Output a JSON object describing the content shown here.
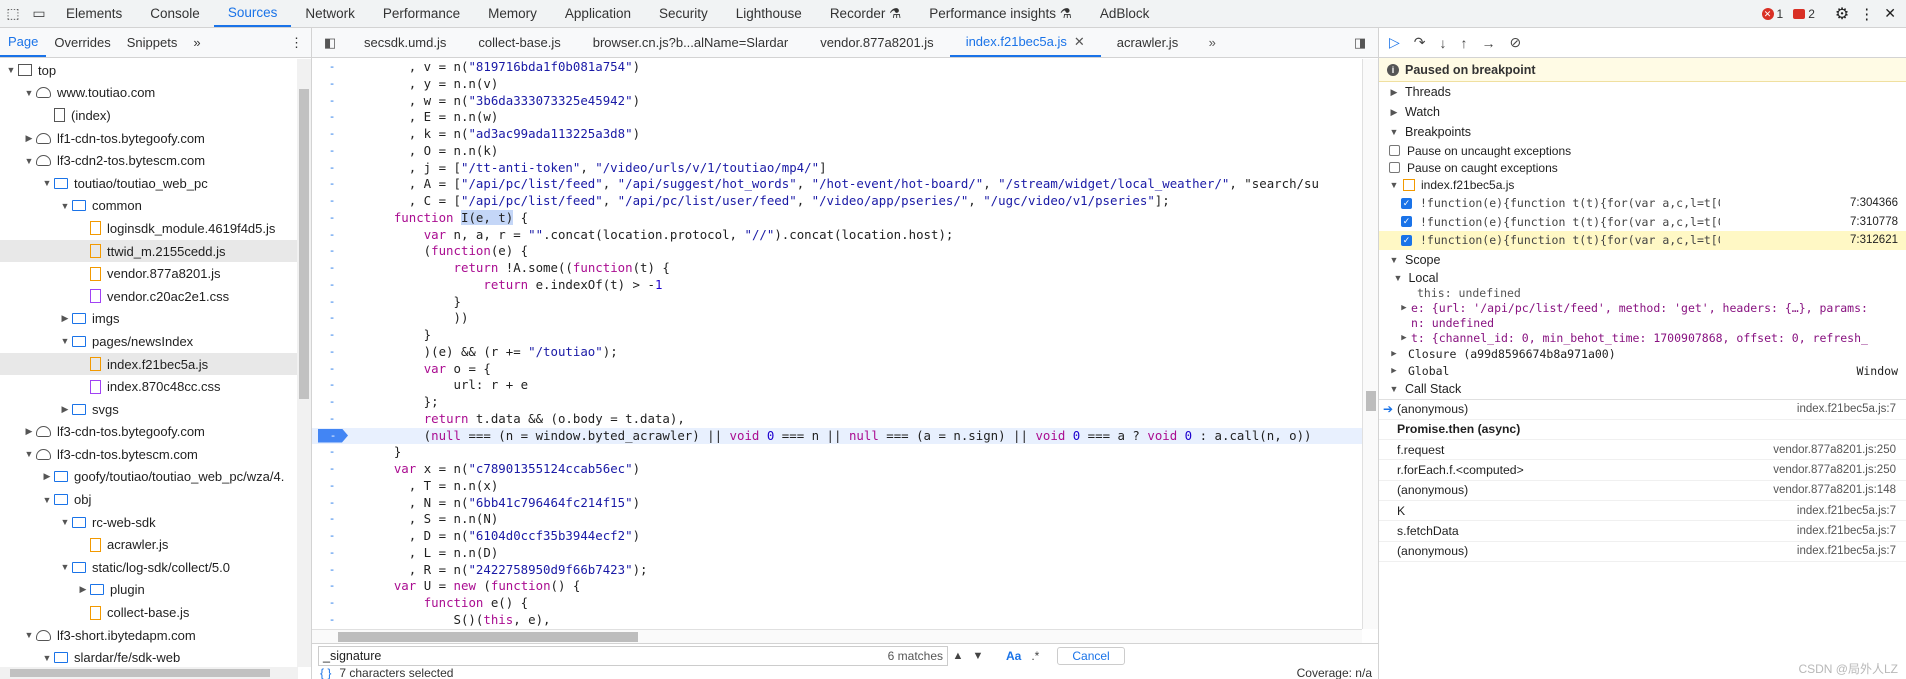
{
  "topbar": {
    "tabs": [
      "Elements",
      "Console",
      "Sources",
      "Network",
      "Performance",
      "Memory",
      "Application",
      "Security",
      "Lighthouse",
      "Recorder",
      "Performance insights",
      "AdBlock"
    ],
    "errors": "1",
    "warnings": "2"
  },
  "navigator": {
    "tabs": [
      "Page",
      "Overrides",
      "Snippets"
    ],
    "tree": [
      {
        "label": "top",
        "icon": "frame-icon",
        "depth": 0,
        "open": true
      },
      {
        "label": "www.toutiao.com",
        "icon": "cloud-icon",
        "depth": 1,
        "open": true
      },
      {
        "label": "(index)",
        "icon": "file-icon",
        "depth": 2
      },
      {
        "label": "lf1-cdn-tos.bytegoofy.com",
        "icon": "cloud-icon",
        "depth": 1,
        "open": false
      },
      {
        "label": "lf3-cdn2-tos.bytescm.com",
        "icon": "cloud-icon",
        "depth": 1,
        "open": true
      },
      {
        "label": "toutiao/toutiao_web_pc",
        "icon": "folder-icon",
        "depth": 2,
        "open": true
      },
      {
        "label": "common",
        "icon": "folder-icon",
        "depth": 3,
        "open": true
      },
      {
        "label": "loginsdk_module.4619f4d5.js",
        "icon": "js-file-icon",
        "depth": 4
      },
      {
        "label": "ttwid_m.2155cedd.js",
        "icon": "js-file-icon",
        "depth": 4,
        "selected": true
      },
      {
        "label": "vendor.877a8201.js",
        "icon": "js-file-icon",
        "depth": 4
      },
      {
        "label": "vendor.c20ac2e1.css",
        "icon": "css-file-icon",
        "depth": 4
      },
      {
        "label": "imgs",
        "icon": "folder-icon",
        "depth": 3,
        "open": false
      },
      {
        "label": "pages/newsIndex",
        "icon": "folder-icon",
        "depth": 3,
        "open": true
      },
      {
        "label": "index.f21bec5a.js",
        "icon": "js-file-icon",
        "depth": 4,
        "selected": true
      },
      {
        "label": "index.870c48cc.css",
        "icon": "css-file-icon",
        "depth": 4
      },
      {
        "label": "svgs",
        "icon": "folder-icon",
        "depth": 3,
        "open": false
      },
      {
        "label": "lf3-cdn-tos.bytegoofy.com",
        "icon": "cloud-icon",
        "depth": 1,
        "open": false
      },
      {
        "label": "lf3-cdn-tos.bytescm.com",
        "icon": "cloud-icon",
        "depth": 1,
        "open": true
      },
      {
        "label": "goofy/toutiao/toutiao_web_pc/wza/4.",
        "icon": "folder-icon",
        "depth": 2,
        "open": false
      },
      {
        "label": "obj",
        "icon": "folder-icon",
        "depth": 2,
        "open": true
      },
      {
        "label": "rc-web-sdk",
        "icon": "folder-icon",
        "depth": 3,
        "open": true
      },
      {
        "label": "acrawler.js",
        "icon": "js-file-icon",
        "depth": 4
      },
      {
        "label": "static/log-sdk/collect/5.0",
        "icon": "folder-icon",
        "depth": 3,
        "open": true
      },
      {
        "label": "plugin",
        "icon": "folder-icon",
        "depth": 4,
        "open": false
      },
      {
        "label": "collect-base.js",
        "icon": "js-file-icon",
        "depth": 4
      },
      {
        "label": "lf3-short.ibytedapm.com",
        "icon": "cloud-icon",
        "depth": 1,
        "open": true
      },
      {
        "label": "slardar/fe/sdk-web",
        "icon": "folder-icon",
        "depth": 2,
        "open": true
      }
    ]
  },
  "editor": {
    "tabs": [
      {
        "label": "secsdk.umd.js",
        "active": false
      },
      {
        "label": "collect-base.js",
        "active": false
      },
      {
        "label": "browser.cn.js?b...alName=Slardar",
        "active": false
      },
      {
        "label": "vendor.877a8201.js",
        "active": false
      },
      {
        "label": "index.f21bec5a.js",
        "active": true
      },
      {
        "label": "acrawler.js",
        "active": false
      }
    ],
    "lines": [
      {
        "ln": "-",
        "code": "      , v = n(\"819716bda1f0b081a754\")"
      },
      {
        "ln": "-",
        "code": "      , y = n.n(v)"
      },
      {
        "ln": "-",
        "code": "      , w = n(\"3b6da333073325e45942\")"
      },
      {
        "ln": "-",
        "code": "      , E = n.n(w)"
      },
      {
        "ln": "-",
        "code": "      , k = n(\"ad3ac99ada113225a3d8\")"
      },
      {
        "ln": "-",
        "code": "      , O = n.n(k)"
      },
      {
        "ln": "-",
        "code": "      , j = [\"/tt-anti-token\", \"/video/urls/v/1/toutiao/mp4/\"]"
      },
      {
        "ln": "-",
        "code": "      , A = [\"/api/pc/list/feed\", \"/api/suggest/hot_words\", \"/hot-event/hot-board/\", \"/stream/widget/local_weather/\", \"search/su"
      },
      {
        "ln": "-",
        "code": "      , C = [\"/api/pc/list/feed\", \"/api/pc/list/user/feed\", \"/video/app/pseries/\", \"/ugc/video/v1/pseries\"];"
      },
      {
        "ln": "-",
        "code": "    function I(e, t) {"
      },
      {
        "ln": "-",
        "code": "        var n, a, r = \"\".concat(location.protocol, \"//\").concat(location.host);"
      },
      {
        "ln": "-",
        "code": "        (function(e) {"
      },
      {
        "ln": "-",
        "code": "            return !A.some((function(t) {"
      },
      {
        "ln": "-",
        "code": "                return e.indexOf(t) > -1"
      },
      {
        "ln": "-",
        "code": "            }"
      },
      {
        "ln": "-",
        "code": "            ))"
      },
      {
        "ln": "-",
        "code": "        }"
      },
      {
        "ln": "-",
        "code": "        )(e) && (r += \"/toutiao\");"
      },
      {
        "ln": "-",
        "code": "        var o = {"
      },
      {
        "ln": "-",
        "code": "            url: r + e"
      },
      {
        "ln": "-",
        "code": "        };"
      },
      {
        "ln": "-",
        "code": "        return t.data && (o.body = t.data),"
      },
      {
        "ln": "-",
        "code": "        (null === (n = window.byted_acrawler) || void 0 === n || null === (a = n.sign) || void 0 === a ? void 0 : a.call(n, o))",
        "bp": true
      },
      {
        "ln": "-",
        "code": "    }"
      },
      {
        "ln": "-",
        "code": "    var x = n(\"c78901355124ccab56ec\")"
      },
      {
        "ln": "-",
        "code": "      , T = n.n(x)"
      },
      {
        "ln": "-",
        "code": "      , N = n(\"6bb41c796464fc214f15\")"
      },
      {
        "ln": "-",
        "code": "      , S = n.n(N)"
      },
      {
        "ln": "-",
        "code": "      , D = n(\"6104d0ccf35b3944ecf2\")"
      },
      {
        "ln": "-",
        "code": "      , L = n.n(D)"
      },
      {
        "ln": "-",
        "code": "      , R = n(\"2422758950d9f66b7423\");"
      },
      {
        "ln": "-",
        "code": "    var U = new (function() {"
      },
      {
        "ln": "-",
        "code": "        function e() {"
      },
      {
        "ln": "-",
        "code": "            S()(this, e),"
      }
    ],
    "search": {
      "value": "_signature",
      "matches": "6 matches",
      "case_label": "Aa",
      "regex_label": ".*",
      "cancel_label": "Cancel"
    },
    "status": {
      "selection": "7 characters selected",
      "coverage": "Coverage: n/a"
    }
  },
  "debugger": {
    "paused": "Paused on breakpoint",
    "sections": {
      "threads": "Threads",
      "watch": "Watch",
      "breakpoints": "Breakpoints",
      "scope": "Scope",
      "callstack": "Call Stack"
    },
    "exceptions": [
      "Pause on uncaught exceptions",
      "Pause on caught exceptions"
    ],
    "bp_file": "index.f21bec5a.js",
    "breakpoints": [
      {
        "code": "!function(e){function t(t){for(var a,c,l=t[0],u=t[1]...",
        "loc": "7:304366"
      },
      {
        "code": "!function(e){function t(t){for(var a,c,l=t[0],u=t[1]...",
        "loc": "7:310778"
      },
      {
        "code": "!function(e){function t(t){for(var a,c,l=t[0],u=t[1]...",
        "loc": "7:312621",
        "current": true
      }
    ],
    "scope": {
      "local_label": "Local",
      "this_line": "this: undefined",
      "e_line": "e: {url: '/api/pc/list/feed', method: 'get', headers: {…}, params:",
      "n_line": "n: undefined",
      "t_line": "t: {channel_id: 0, min_behot_time: 1700907868, offset: 0, refresh_",
      "closure": "Closure (a99d8596674b8a971a00)",
      "global": "Global",
      "global_val": "Window"
    },
    "callstack": [
      {
        "fn": "(anonymous)",
        "loc": "index.f21bec5a.js:7",
        "current": true
      },
      {
        "fn": "Promise.then (async)",
        "loc": "",
        "async": true
      },
      {
        "fn": "f.request",
        "loc": "vendor.877a8201.js:250"
      },
      {
        "fn": "r.forEach.f.<computed>",
        "loc": "vendor.877a8201.js:250"
      },
      {
        "fn": "(anonymous)",
        "loc": "vendor.877a8201.js:148"
      },
      {
        "fn": "K",
        "loc": "index.f21bec5a.js:7"
      },
      {
        "fn": "s.fetchData",
        "loc": "index.f21bec5a.js:7"
      },
      {
        "fn": "(anonymous)",
        "loc": "index.f21bec5a.js:7"
      }
    ],
    "watermark": "CSDN @局外人LZ"
  }
}
